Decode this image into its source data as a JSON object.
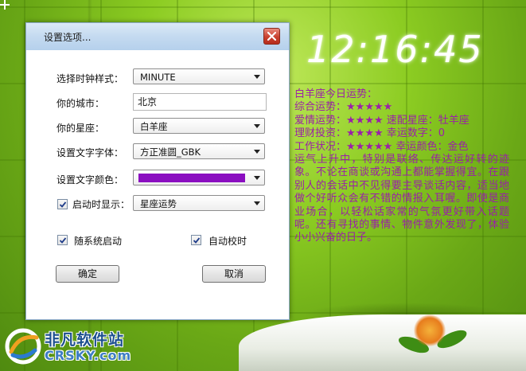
{
  "clock": {
    "time": "12:16:45"
  },
  "fortune": {
    "header": "白羊座今日运势：",
    "overall_label": "综合运势：",
    "overall_stars": "★★★★★",
    "love_label": "爱情运势：",
    "love_stars": "★★★★",
    "match_label": "速配星座：",
    "match_value": "牡羊座",
    "finance_label": "理财投资：",
    "finance_stars": "★★★★",
    "lucky_number_label": "幸运数字：",
    "lucky_number_value": "0",
    "work_label": "工作状况：",
    "work_stars": "★★★★★",
    "lucky_color_label": "幸运颜色：",
    "lucky_color_value": "金色",
    "description": "运气上升中，特别是联络、传达运好转的迹象。不论在商谈或沟通上都能掌握得宜。在跟别人的会话中不见得要主导谈话内容，适当地做个好听众会有不错的情报入耳喔。即使是商业场合，以轻松话家常的气氛更好带入话题呢。还有寻找的事情、物件意外发现了，体验小小兴奋的日子。"
  },
  "dialog": {
    "title": "设置选项...",
    "clock_style_label": "选择时钟样式：",
    "clock_style_value": "MINUTE",
    "city_label": "你的城市：",
    "city_value": "北京",
    "zodiac_label": "你的星座：",
    "zodiac_value": "白羊座",
    "font_label": "设置文字字体：",
    "font_value": "方正准圆_GBK",
    "color_label": "设置文字颜色：",
    "text_color": "#8a0ec0",
    "startup_display_label": "启动时显示：",
    "startup_display_checked": true,
    "startup_display_value": "星座运势",
    "autostart_label": "随系统启动",
    "autostart_checked": true,
    "autosync_label": "自动校时",
    "autosync_checked": true,
    "ok_label": "确定",
    "cancel_label": "取消"
  },
  "watermark": {
    "name_cn": "非凡软件站",
    "name_en": "CRSKY.com"
  },
  "icons": [
    "close-icon",
    "dropdown-arrow-icon",
    "checkmark-icon",
    "crsky-logo-icon"
  ]
}
